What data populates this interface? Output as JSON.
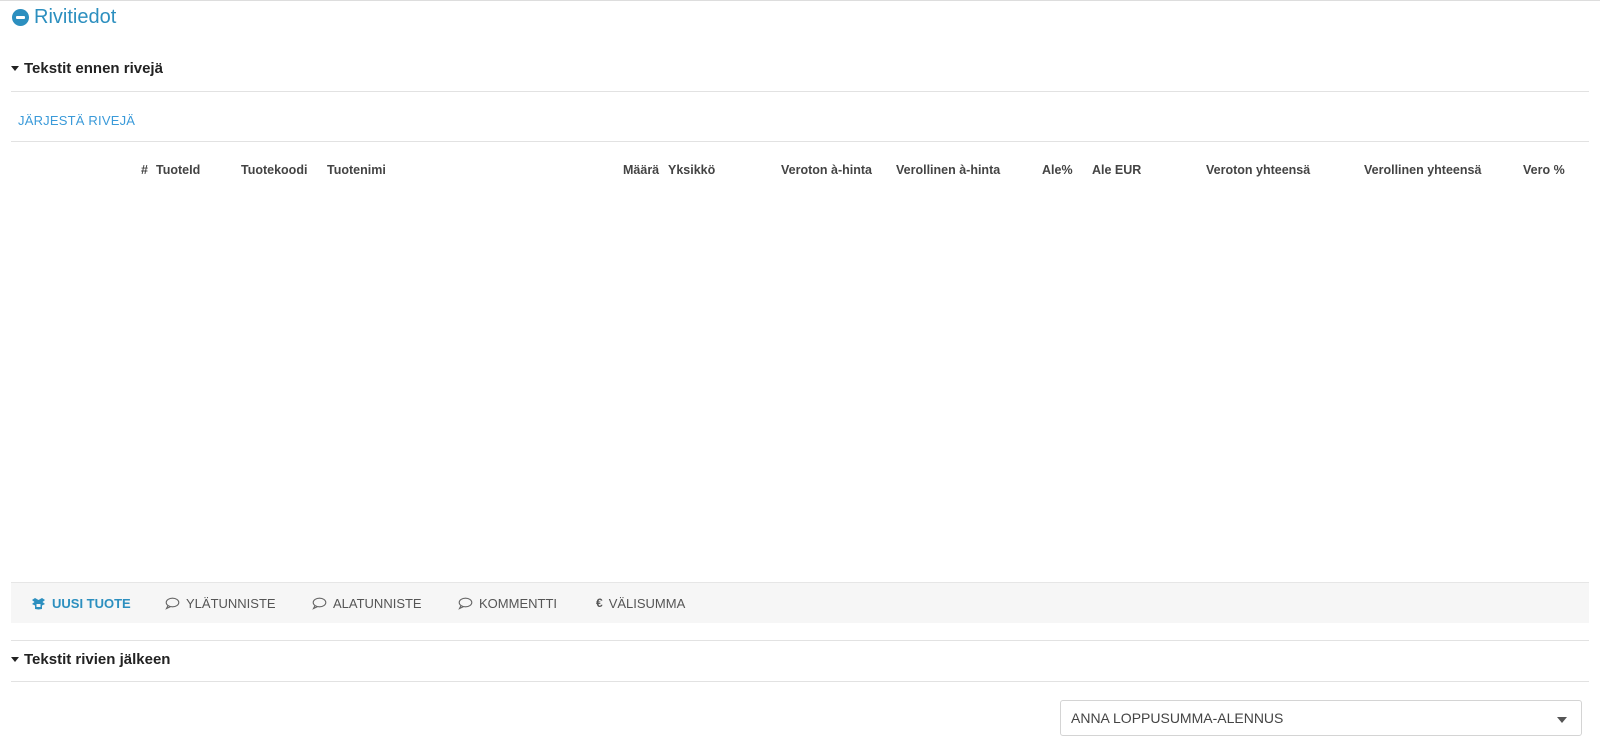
{
  "section": {
    "title": "Rivitiedot"
  },
  "texts_before": {
    "label": "Tekstit ennen rivejä"
  },
  "sort_link": "JÄRJESTÄ RIVEJÄ",
  "table": {
    "columns": [
      {
        "key": "hash",
        "label": "#"
      },
      {
        "key": "tuoteid",
        "label": "TuoteId"
      },
      {
        "key": "tuotekoodi",
        "label": "Tuotekoodi"
      },
      {
        "key": "tuotenimi",
        "label": "Tuotenimi"
      },
      {
        "key": "maara",
        "label": "Määrä"
      },
      {
        "key": "yksikko",
        "label": "Yksikkö"
      },
      {
        "key": "veroton_ahinta",
        "label": "Veroton à-hinta"
      },
      {
        "key": "verollinen_ahinta",
        "label": "Verollinen à-hinta"
      },
      {
        "key": "ale_pct",
        "label": "Ale%"
      },
      {
        "key": "ale_eur",
        "label": "Ale EUR"
      },
      {
        "key": "veroton_yht",
        "label": "Veroton yhteensä"
      },
      {
        "key": "verollinen_yht",
        "label": "Verollinen yhteensä"
      },
      {
        "key": "vero_pct",
        "label": "Vero %"
      }
    ],
    "rows": []
  },
  "toolbar": {
    "new_product": "UUSI TUOTE",
    "header": "YLÄTUNNISTE",
    "footer": "ALATUNNISTE",
    "comment": "KOMMENTTI",
    "subtotal": "VÄLISUMMA"
  },
  "texts_after": {
    "label": "Tekstit rivien jälkeen"
  },
  "discount_select": {
    "value": "ANNA LOPPUSUMMA-ALENNUS"
  },
  "colors": {
    "accent": "#2c8fbf",
    "link": "#3a9ad9",
    "toolbar_bg": "#f6f6f6"
  }
}
